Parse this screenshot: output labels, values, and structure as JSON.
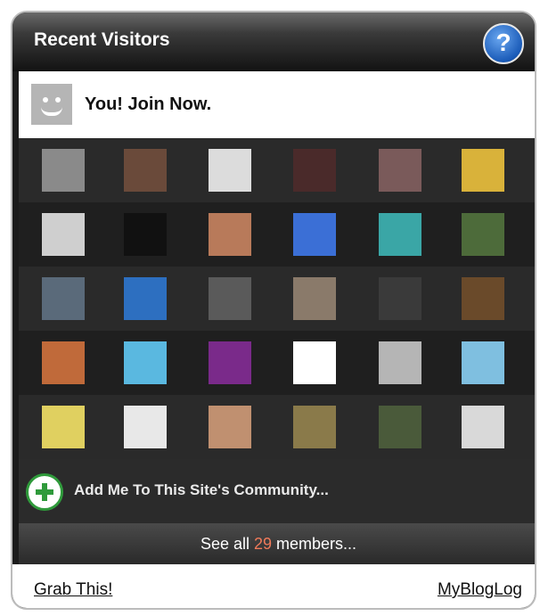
{
  "header": {
    "title": "Recent Visitors",
    "help_icon": "question-icon"
  },
  "join": {
    "label": "You! Join Now."
  },
  "visitors": [
    [
      "#8a8a8a",
      "#6a4a3a",
      "#dcdcdc",
      "#4a2a2a",
      "#7a5a5a",
      "#d9b23a"
    ],
    [
      "#cfcfcf",
      "#111111",
      "#b87a5a",
      "#3b6fd6",
      "#3aa6a6",
      "#4d6b3a"
    ],
    [
      "#5a6a7a",
      "#2d6fc0",
      "#5a5a5a",
      "#8a7a6a",
      "#3a3a3a",
      "#6a4a2a"
    ],
    [
      "#c06a3a",
      "#5ab8e0",
      "#7a2a8a",
      "#ffffff",
      "#b5b5b5",
      "#7fbfe0"
    ],
    [
      "#e0d060",
      "#e8e8e8",
      "#c09070",
      "#8a7a4a",
      "#4a5a3a",
      "#d9d9d9"
    ]
  ],
  "add": {
    "label": "Add Me To This Site's Community..."
  },
  "see_all": {
    "prefix": "See all ",
    "count": "29",
    "suffix": " members..."
  },
  "footer": {
    "grab": "Grab This!",
    "myblog": "MyBlogLog"
  }
}
